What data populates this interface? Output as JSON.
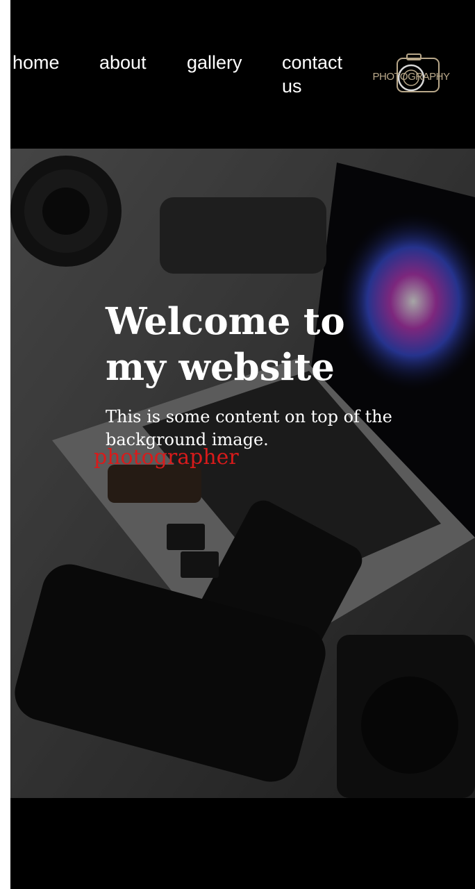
{
  "nav": {
    "items": [
      {
        "label": "home"
      },
      {
        "label": "about"
      },
      {
        "label": "gallery"
      },
      {
        "label": "contact us"
      }
    ]
  },
  "logo": {
    "text": "PHOTOGRAPHY",
    "icon": "camera-logo-icon",
    "color": "#b9a88a"
  },
  "hero": {
    "title": "Welcome to my website",
    "body": "This is some content on top of the background image.",
    "role": "photographer",
    "background": "photography-gear-desk-image"
  },
  "colors": {
    "page_bg": "#000000",
    "text": "#ffffff",
    "accent": "#d81b1b"
  }
}
